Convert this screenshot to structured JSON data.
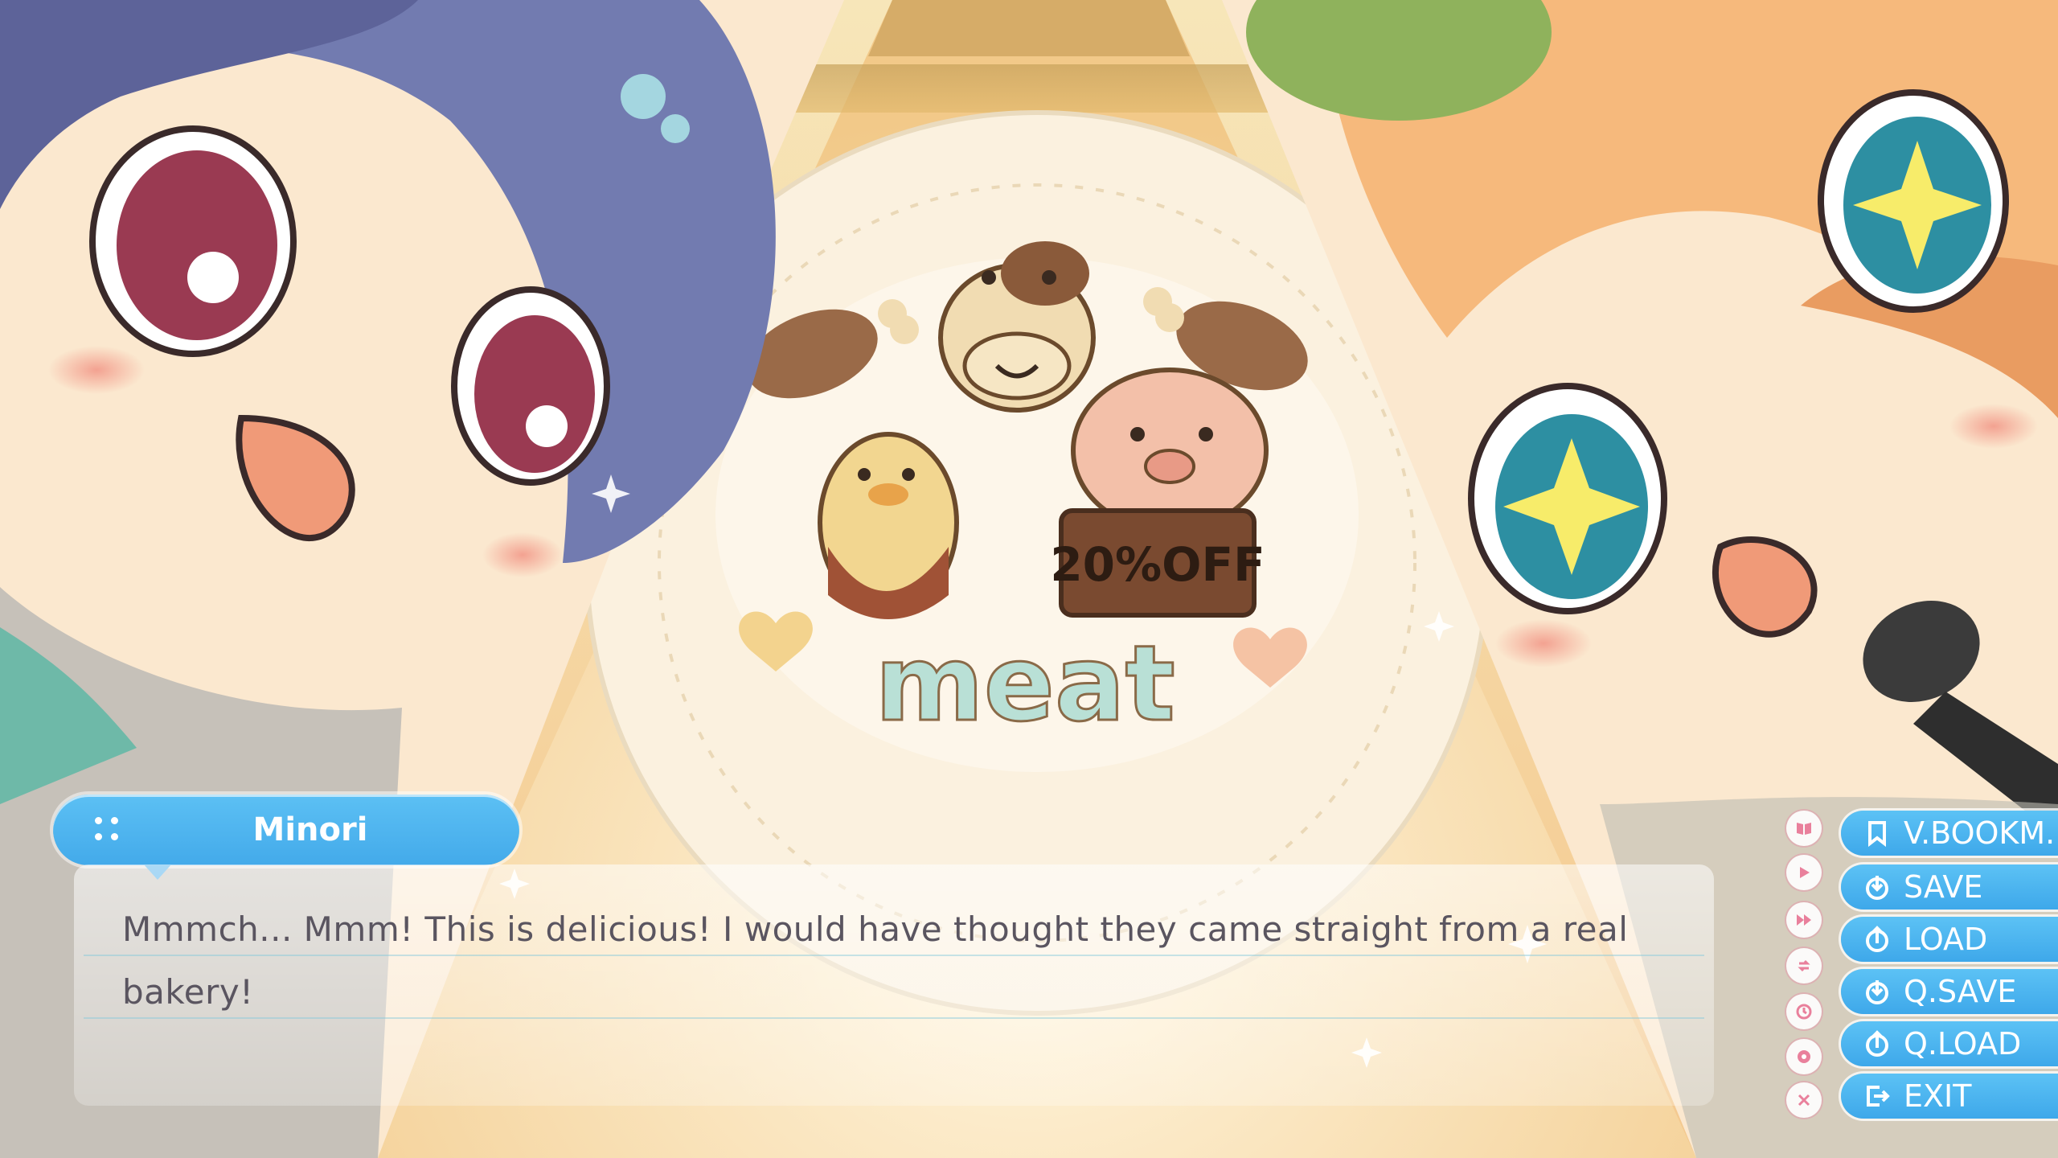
{
  "speaker": {
    "name": "Minori"
  },
  "dialogue": {
    "text": "Mmmch... Mmm! This is delicious! I would have thought they came straight from a real bakery!"
  },
  "artwork": {
    "sign_text": "20%OFF",
    "cookie_word": "meat"
  },
  "quick_icons": [
    "book-icon",
    "play-icon",
    "fast-forward-icon",
    "auto-icon",
    "history-icon",
    "settings-icon",
    "close-icon"
  ],
  "menu": {
    "bookmark": "V.BOOKM.",
    "save": "SAVE",
    "load": "LOAD",
    "qsave": "Q.SAVE",
    "qload": "Q.LOAD",
    "exit": "EXIT"
  },
  "colors": {
    "accent": "#4cb4ef",
    "text": "#5a5560",
    "icon_pink": "#e9809c"
  }
}
